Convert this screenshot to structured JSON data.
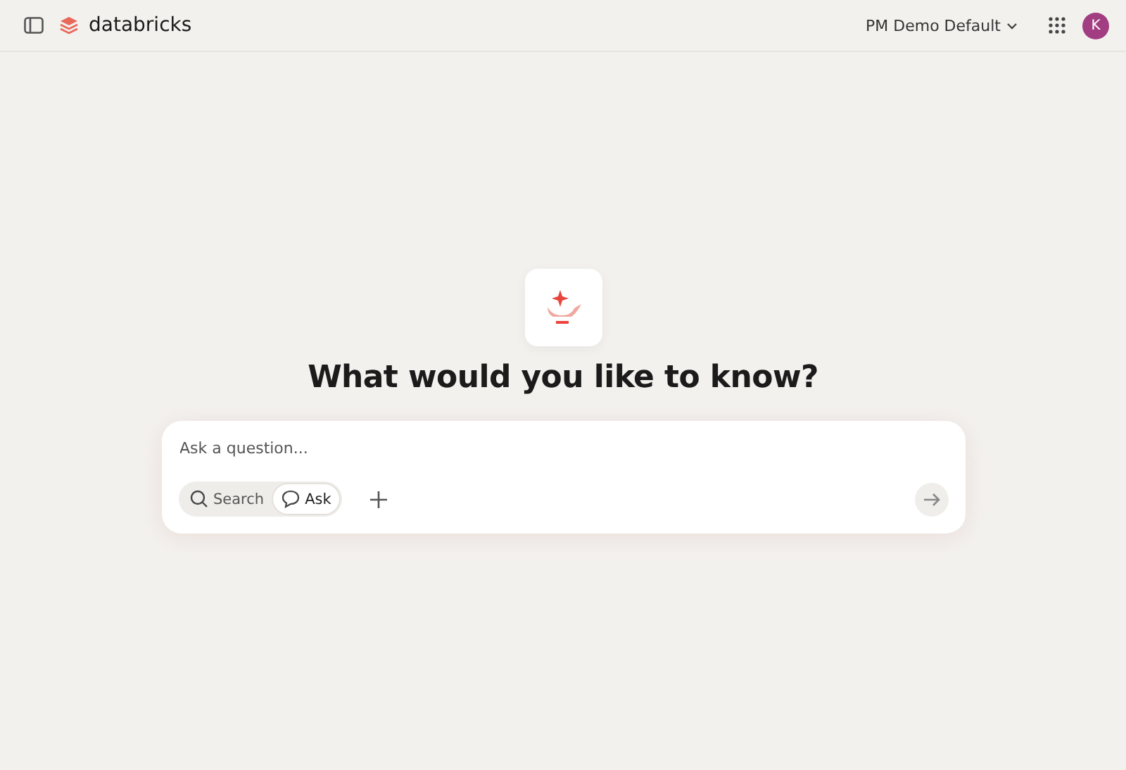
{
  "header": {
    "brand": "databricks",
    "workspace": "PM Demo Default",
    "avatar": "K"
  },
  "hero": {
    "title": "What would you like to know?"
  },
  "composer": {
    "placeholder": "Ask a question...",
    "modes": [
      {
        "label": "Search",
        "kind": "search",
        "selected": false
      },
      {
        "label": "Ask",
        "kind": "chat",
        "selected": true
      }
    ]
  }
}
